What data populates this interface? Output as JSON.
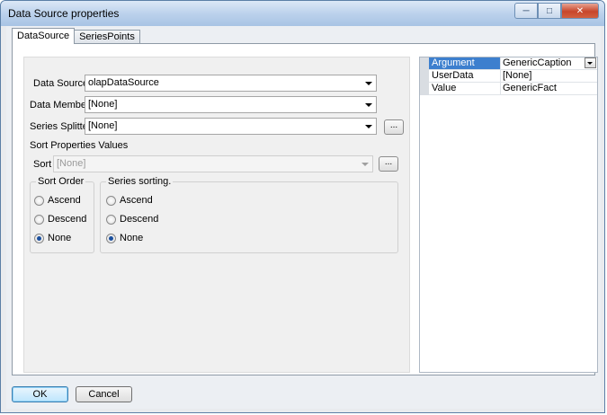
{
  "window": {
    "title": "Data Source properties"
  },
  "tabs": [
    {
      "label": "DataSource"
    },
    {
      "label": "SeriesPoints"
    }
  ],
  "form": {
    "data_source": {
      "label": "Data Source",
      "value": "olapDataSource"
    },
    "data_member": {
      "label": "Data Member",
      "value": "[None]"
    },
    "series_splitter": {
      "label": "Series Splitter",
      "value": "[None]",
      "button": "..."
    },
    "sort_properties": {
      "title": "Sort Properties Values",
      "sort_label": "Sort",
      "sort_value": "[None]",
      "button": "...",
      "sort_order": {
        "title": "Sort Order",
        "options": [
          "Ascend",
          "Descend",
          "None"
        ],
        "selected": "None"
      },
      "series_sorting": {
        "title": "Series sorting.",
        "options": [
          "Ascend",
          "Descend",
          "None"
        ],
        "selected": "None"
      }
    }
  },
  "property_grid": {
    "rows": [
      {
        "name": "Argument",
        "value": "GenericCaption"
      },
      {
        "name": "UserData",
        "value": "[None]"
      },
      {
        "name": "Value",
        "value": "GenericFact"
      }
    ]
  },
  "buttons": {
    "ok": "OK",
    "cancel": "Cancel"
  },
  "icons": {
    "minimize": "minimize-icon",
    "maximize": "maximize-icon",
    "close": "close-icon",
    "dropdown": "chevron-down-icon"
  }
}
